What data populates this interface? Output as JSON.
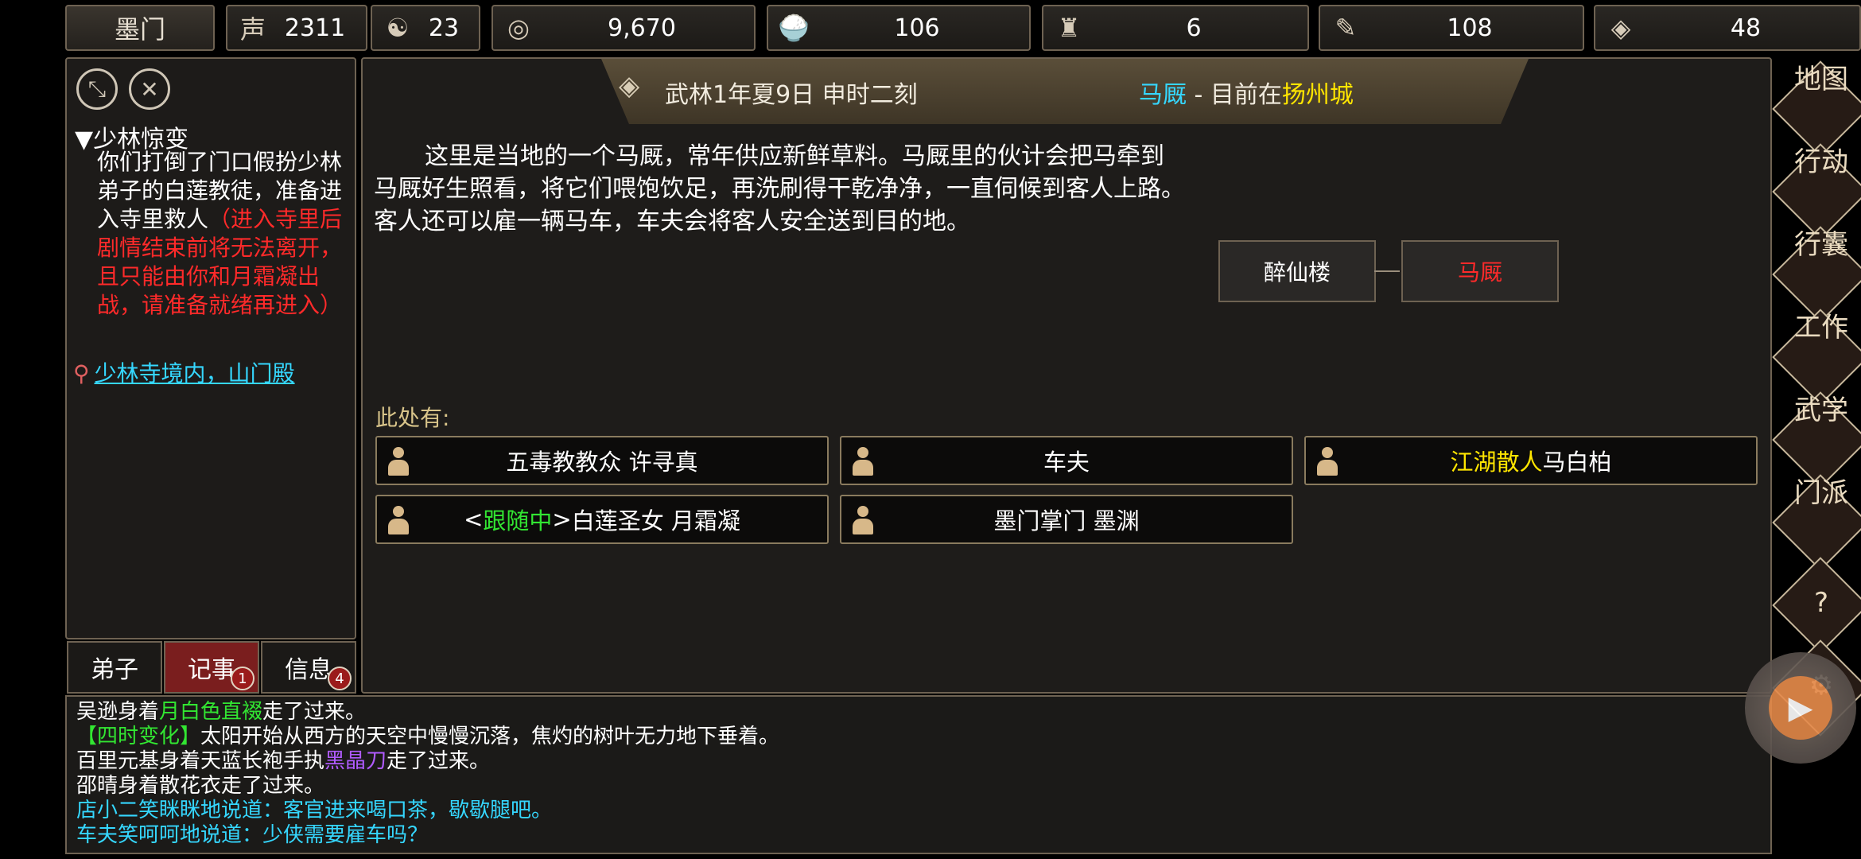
{
  "top_bar": {
    "sect_name": "墨门",
    "resources": [
      {
        "icon": "reputation-icon",
        "glyph": "声",
        "value": "2311"
      },
      {
        "icon": "yin-yang-icon",
        "glyph": "☯",
        "value": "23"
      },
      {
        "icon": "coin-icon",
        "glyph": "◎",
        "value": "9,670"
      },
      {
        "icon": "food-bowl-icon",
        "glyph": "🍚",
        "value": "106"
      },
      {
        "icon": "gourd-icon",
        "glyph": "♜",
        "value": "6"
      },
      {
        "icon": "scroll-icon",
        "glyph": "✎",
        "value": "108"
      },
      {
        "icon": "ore-icon",
        "glyph": "◈",
        "value": "48"
      }
    ]
  },
  "quest": {
    "title": "▼少林惊变",
    "body_normal": "你们打倒了门口假扮少林弟子的白莲教徒，准备进入寺里救人",
    "body_red": "（进入寺里后剧情结束前将无法离开，且只能由你和月霜凝出战，请准备就绪再进入）",
    "location": "少林寺境内，山门殿"
  },
  "tabs": [
    {
      "label": "弟子",
      "badge": ""
    },
    {
      "label": "记事",
      "badge": "1"
    },
    {
      "label": "信息",
      "badge": "4"
    }
  ],
  "banner": {
    "time": "武林1年夏9日 申时二刻",
    "place": "马厩",
    "sep": " - 目前在",
    "city": "扬州城"
  },
  "description": "这里是当地的一个马厩，常年供应新鲜草料。马厩里的伙计会把马牵到马厩好生照看，将它们喂饱饮足，再洗刷得干乾净净，一直伺候到客人上路。客人还可以雇一辆马车，车夫会将客人安全送到目的地。",
  "map": {
    "left": "醉仙楼",
    "current": "马厩"
  },
  "here_label": "此处有:",
  "npcs": [
    {
      "prefix": "",
      "tag": "",
      "suffix": "",
      "name": "五毒教教众 许寻真"
    },
    {
      "prefix": "",
      "tag": "",
      "suffix": "",
      "name": "车夫"
    },
    {
      "prefix": "",
      "tag": "江湖散人",
      "suffix": "",
      "name": " 马白柏"
    },
    {
      "prefix": "<",
      "tag": "跟随中",
      "suffix": ">",
      "name": "白莲圣女 月霜凝"
    },
    {
      "prefix": "",
      "tag": "",
      "suffix": "",
      "name": "墨门掌门 墨渊"
    }
  ],
  "log": [
    {
      "a": "吴逊身着",
      "hl": "月白色直裰",
      "b": "走了过来。"
    },
    {
      "a": "",
      "hl": "【四时变化】",
      "b": "太阳开始从西方的天空中慢慢沉落，焦灼的树叶无力地下垂着。"
    },
    {
      "a": "百里元基身着天蓝长袍手执",
      "hl": "黑晶刀",
      "b": "走了过来。"
    },
    {
      "a": "邵晴身着散花衣走了过来。",
      "hl": "",
      "b": ""
    },
    {
      "a": "店小二笑眯眯地说道：客官进来喝口茶，歇歇腿吧。",
      "hl": "",
      "b": ""
    },
    {
      "a": "车夫笑呵呵地说道：少侠需要雇车吗？",
      "hl": "",
      "b": ""
    }
  ],
  "right_menu": [
    "地图",
    "行动",
    "行囊",
    "工作",
    "武学",
    "门派",
    "?",
    "⚙"
  ]
}
